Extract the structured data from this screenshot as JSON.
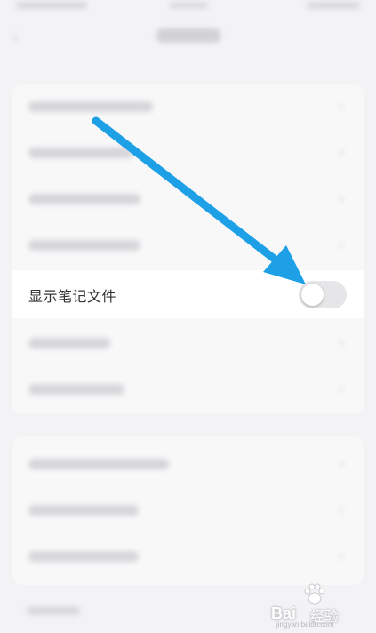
{
  "setting": {
    "label": "显示笔记文件",
    "toggle_state": "off"
  },
  "icons": {
    "back": "back-arrow-icon",
    "chevron": "chevron-right-icon",
    "annotation": "annotation-arrow-icon",
    "watermark": "baidu-paw-icon"
  },
  "colors": {
    "arrow": "#1ea0e6",
    "toggle_off": "#e6e6e8",
    "highlight_bg": "#ffffff"
  },
  "watermark": {
    "brand": "Bai",
    "brand_suffix": "经验",
    "url": "jingyan.baidu.com"
  }
}
